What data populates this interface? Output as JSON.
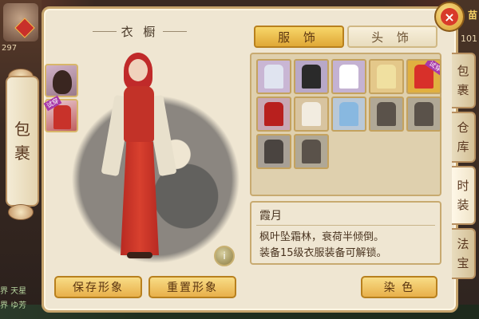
{
  "hud": {
    "left_number": "297",
    "right_text": "苗",
    "right_number": "101",
    "chat_lines": [
      "界 天星",
      "界 ゆ芳"
    ]
  },
  "left_tab": {
    "chars": [
      "包",
      "裹"
    ]
  },
  "panel": {
    "title": "衣 橱",
    "info_icon": "i",
    "tabs": [
      {
        "label": "服 饰",
        "active": true
      },
      {
        "label": "头 饰",
        "active": false
      }
    ],
    "equipped": [
      {
        "name": "hair-slot",
        "badge": ""
      },
      {
        "name": "cloth-slot",
        "badge": "试穿"
      }
    ],
    "items": [
      {
        "bg": "#c9b6d4",
        "garb": "#e0e4f0",
        "badge": ""
      },
      {
        "bg": "#b8a8c8",
        "garb": "#2a2a2a",
        "badge": ""
      },
      {
        "bg": "#c4b2d2",
        "garb": "#ffffff",
        "badge": ""
      },
      {
        "bg": "#e4c88a",
        "garb": "#f0e0a0",
        "badge": ""
      },
      {
        "bg": "#e0b040",
        "garb": "#d8302a",
        "badge": "试穿"
      },
      {
        "bg": "#c8a8b4",
        "garb": "#b8201e",
        "badge": ""
      },
      {
        "bg": "#d8c4a0",
        "garb": "#f2ece0",
        "badge": ""
      },
      {
        "bg": "#b8c8d8",
        "garb": "#88b8e0",
        "badge": ""
      },
      {
        "bg": "#b0a896",
        "garb": "#5a524a",
        "badge": ""
      },
      {
        "bg": "#b0a896",
        "garb": "#5a524a",
        "badge": ""
      },
      {
        "bg": "#a8a096",
        "garb": "#4a4440",
        "badge": ""
      },
      {
        "bg": "#b0a896",
        "garb": "#5a524a",
        "badge": ""
      }
    ],
    "description": {
      "name": "霞月",
      "lines": [
        "枫叶坠霜林，衰荷半倾倒。",
        "装备15级衣服装备可解锁。"
      ]
    },
    "buttons": {
      "save": "保存形象",
      "reset": "重置形象",
      "dye": "染 色"
    },
    "close_icon": "×"
  },
  "side_tabs": [
    {
      "chars": [
        "包",
        "裹"
      ],
      "active": false
    },
    {
      "chars": [
        "仓",
        "库"
      ],
      "active": false
    },
    {
      "chars": [
        "时",
        "装"
      ],
      "active": true
    },
    {
      "chars": [
        "法",
        "宝"
      ],
      "active": false
    }
  ]
}
